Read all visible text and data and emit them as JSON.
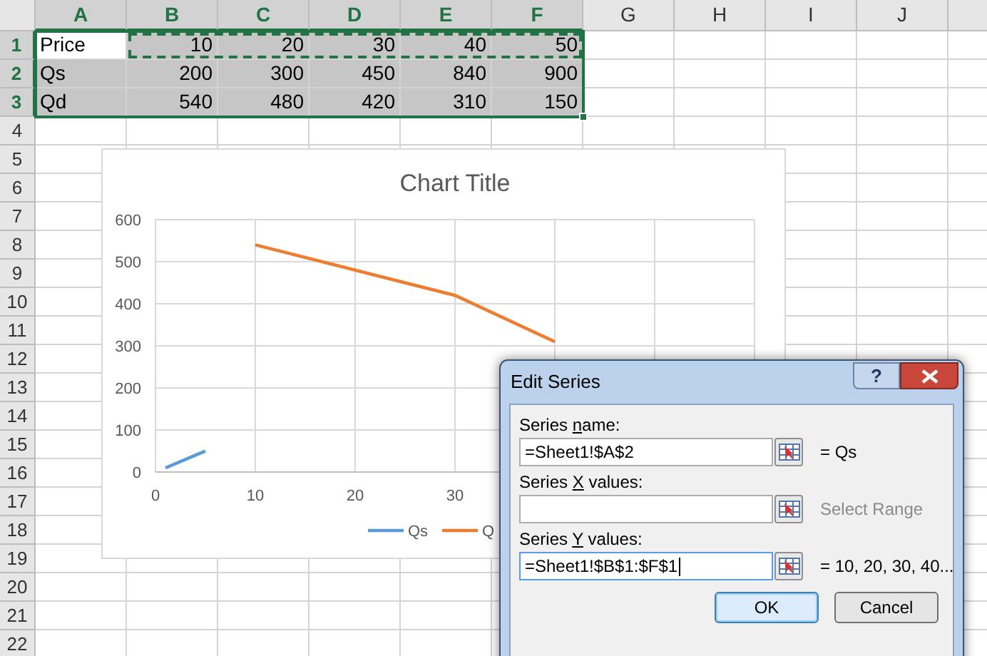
{
  "sheet": {
    "columns": [
      {
        "label": "A",
        "selected": true
      },
      {
        "label": "B",
        "selected": true
      },
      {
        "label": "C",
        "selected": true
      },
      {
        "label": "D",
        "selected": true
      },
      {
        "label": "E",
        "selected": true
      },
      {
        "label": "F",
        "selected": true
      },
      {
        "label": "G",
        "selected": false
      },
      {
        "label": "H",
        "selected": false
      },
      {
        "label": "I",
        "selected": false
      },
      {
        "label": "J",
        "selected": false
      }
    ],
    "rows": [
      {
        "header": "1",
        "selected": true,
        "cells": [
          {
            "text": "Price",
            "kind": "text",
            "active": true,
            "copied": false
          },
          {
            "text": "10",
            "kind": "number",
            "active": false,
            "copied": true
          },
          {
            "text": "20",
            "kind": "number",
            "active": false,
            "copied": true
          },
          {
            "text": "30",
            "kind": "number",
            "active": false,
            "copied": true
          },
          {
            "text": "40",
            "kind": "number",
            "active": false,
            "copied": true
          },
          {
            "text": "50",
            "kind": "number",
            "active": false,
            "copied": true
          }
        ]
      },
      {
        "header": "2",
        "selected": true,
        "cells": [
          {
            "text": "Qs",
            "kind": "text",
            "active": false,
            "copied": false
          },
          {
            "text": "200",
            "kind": "number",
            "active": false,
            "copied": false
          },
          {
            "text": "300",
            "kind": "number",
            "active": false,
            "copied": false
          },
          {
            "text": "450",
            "kind": "number",
            "active": false,
            "copied": false
          },
          {
            "text": "840",
            "kind": "number",
            "active": false,
            "copied": false
          },
          {
            "text": "900",
            "kind": "number",
            "active": false,
            "copied": false
          }
        ]
      },
      {
        "header": "3",
        "selected": true,
        "cells": [
          {
            "text": "Qd",
            "kind": "text",
            "active": false,
            "copied": false
          },
          {
            "text": "540",
            "kind": "number",
            "active": false,
            "copied": false
          },
          {
            "text": "480",
            "kind": "number",
            "active": false,
            "copied": false
          },
          {
            "text": "420",
            "kind": "number",
            "active": false,
            "copied": false
          },
          {
            "text": "310",
            "kind": "number",
            "active": false,
            "copied": false
          },
          {
            "text": "150",
            "kind": "number",
            "active": false,
            "copied": false
          }
        ]
      },
      {
        "header": "4",
        "selected": false
      },
      {
        "header": "5",
        "selected": false
      },
      {
        "header": "6",
        "selected": false
      },
      {
        "header": "7",
        "selected": false
      },
      {
        "header": "8",
        "selected": false
      },
      {
        "header": "9",
        "selected": false
      },
      {
        "header": "10",
        "selected": false
      },
      {
        "header": "11",
        "selected": false
      },
      {
        "header": "12",
        "selected": false
      },
      {
        "header": "13",
        "selected": false
      },
      {
        "header": "14",
        "selected": false
      },
      {
        "header": "15",
        "selected": false
      },
      {
        "header": "16",
        "selected": false
      },
      {
        "header": "17",
        "selected": false
      },
      {
        "header": "18",
        "selected": false
      },
      {
        "header": "19",
        "selected": false
      },
      {
        "header": "20",
        "selected": false
      },
      {
        "header": "21",
        "selected": false
      },
      {
        "header": "22",
        "selected": false
      }
    ]
  },
  "chart": {
    "chart_data": {
      "type": "line",
      "title": "Chart Title",
      "x": [
        1,
        2,
        3,
        4,
        5,
        10,
        20,
        30,
        40
      ],
      "series": [
        {
          "name": "Qs",
          "color": "#5b9bd5",
          "values": [
            10,
            20,
            30,
            40,
            50,
            null,
            null,
            null,
            null
          ]
        },
        {
          "name": "Q",
          "color": "#ed7d31",
          "values": [
            null,
            null,
            null,
            null,
            null,
            540,
            480,
            420,
            310
          ]
        }
      ],
      "grid": true,
      "legend": true,
      "xlim": [
        0,
        60
      ],
      "ylim": [
        0,
        600
      ],
      "xticks": [
        {
          "value": 0,
          "label": "0"
        },
        {
          "value": 10,
          "label": "10"
        },
        {
          "value": 20,
          "label": "20"
        },
        {
          "value": 30,
          "label": "30"
        }
      ],
      "yticks": [
        {
          "value": 0,
          "label": "0"
        },
        {
          "value": 100,
          "label": "100"
        },
        {
          "value": 200,
          "label": "200"
        },
        {
          "value": 300,
          "label": "300"
        },
        {
          "value": 400,
          "label": "400"
        },
        {
          "value": 500,
          "label": "500"
        },
        {
          "value": 600,
          "label": "600"
        }
      ]
    }
  },
  "dialog": {
    "title": "Edit Series",
    "help": "?",
    "fields": [
      {
        "label_parts": [
          "Series ",
          "n",
          "ame:"
        ],
        "value": "=Sheet1!$A$2",
        "result": "= Qs",
        "result_muted": false,
        "focused": false
      },
      {
        "label_parts": [
          "Series ",
          "X",
          " values:"
        ],
        "result": "Select Range",
        "result_muted": true,
        "focused": false
      },
      {
        "label_parts": [
          "Series ",
          "Y",
          " values:"
        ],
        "value": "=Sheet1!$B$1:$F$1",
        "result": "= 10, 20, 30, 40...",
        "result_muted": false,
        "focused": true
      }
    ],
    "buttons": [
      {
        "label": "OK",
        "default": true
      },
      {
        "label": "Cancel",
        "default": false
      }
    ]
  }
}
